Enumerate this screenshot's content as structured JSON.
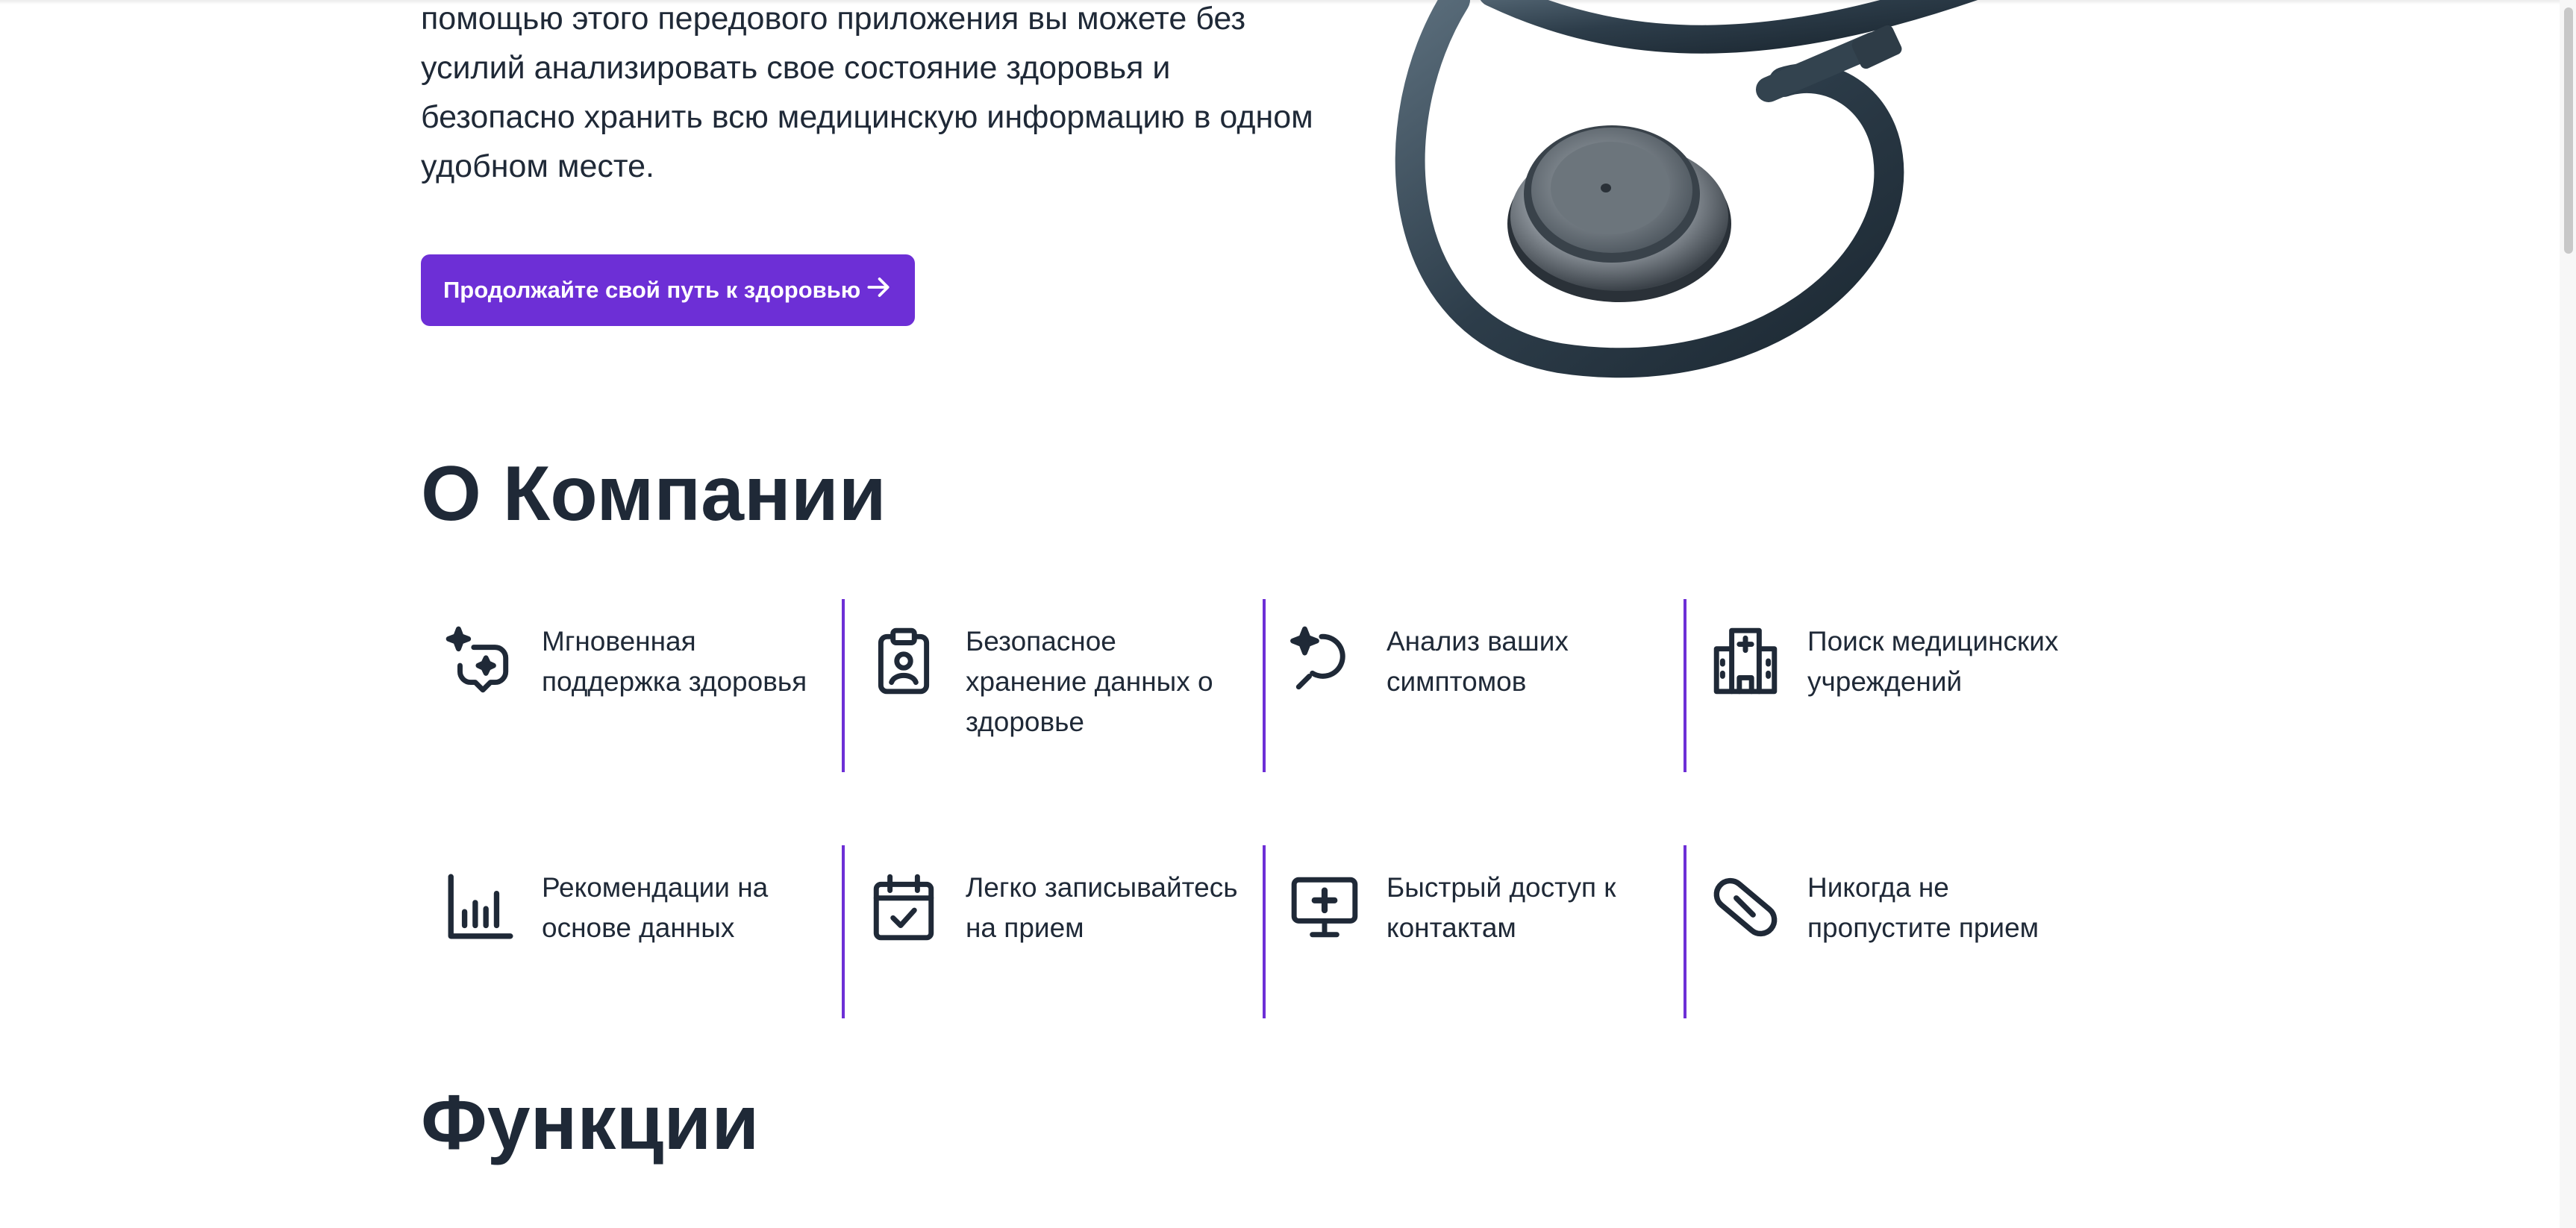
{
  "hero": {
    "text": "помощью этого передового приложения вы можете без усилий анализировать свое состояние здоровья и безопасно хранить всю медицинскую информацию в одном удобном месте.",
    "cta_label": "Продолжайте свой путь к здоровью",
    "cta_icon": "arrow-right-icon",
    "image": "stethoscope-image"
  },
  "about": {
    "title": "О Компании",
    "features": [
      {
        "label": "Мгновенная поддержка здоровья",
        "icon": "sparkle-chat-icon"
      },
      {
        "label": "Безопасное хранение данных о здоровье",
        "icon": "clipboard-user-icon"
      },
      {
        "label": "Анализ ваших симптомов",
        "icon": "sparkle-search-icon"
      },
      {
        "label": "Поиск медицинских учреждений",
        "icon": "hospital-icon"
      },
      {
        "label": "Рекомендации на основе данных",
        "icon": "bar-chart-icon"
      },
      {
        "label": "Легко записывайтесь на прием",
        "icon": "calendar-check-icon"
      },
      {
        "label": "Быстрый доступ к контактам",
        "icon": "monitor-plus-icon"
      },
      {
        "label": "Никогда не пропустите прием",
        "icon": "pill-icon"
      }
    ]
  },
  "functions": {
    "title": "Функции"
  },
  "colors": {
    "accent": "#6d2fd6",
    "text": "#1f2937"
  }
}
